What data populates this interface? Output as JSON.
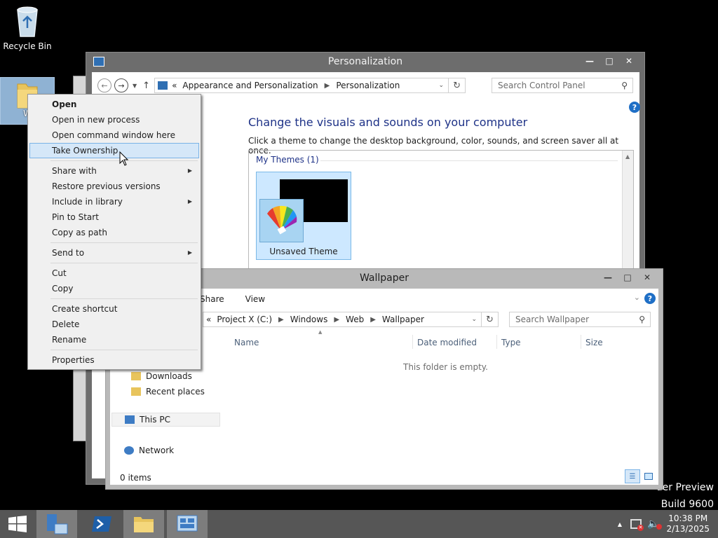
{
  "desktop": {
    "recycle_bin_label": "Recycle Bin",
    "folder_label": "W",
    "watermark_line1": "der Preview",
    "watermark_line2": "Build 9600"
  },
  "personalization": {
    "title": "Personalization",
    "breadcrumb": [
      "«",
      "Appearance and Personalization",
      "Personalization"
    ],
    "search_placeholder": "Search Control Panel",
    "heading": "Change the visuals and sounds on your computer",
    "subheading": "Click a theme to change the desktop background, color, sounds, and screen saver all at once.",
    "themes_header": "My Themes (1)",
    "theme_name": "Unsaved Theme"
  },
  "explorer": {
    "title": "Wallpaper",
    "ribbon_tabs": [
      "Share",
      "View"
    ],
    "breadcrumb": [
      "«",
      "Project X (C:)",
      "Windows",
      "Web",
      "Wallpaper"
    ],
    "search_placeholder": "Search Wallpaper",
    "columns": [
      "Name",
      "Date modified",
      "Type",
      "Size"
    ],
    "empty_message": "This folder is empty.",
    "nav": {
      "downloads": "Downloads",
      "recent": "Recent places",
      "this_pc": "This PC",
      "network": "Network"
    },
    "status": "0 items"
  },
  "context_menu": {
    "items": [
      {
        "label": "Open"
      },
      {
        "label": "Open in new process"
      },
      {
        "label": "Open command window here"
      },
      {
        "label": "Take Ownership"
      },
      {
        "label": "Share with"
      },
      {
        "label": "Restore previous versions"
      },
      {
        "label": "Include in library"
      },
      {
        "label": "Pin to Start"
      },
      {
        "label": "Copy as path"
      },
      {
        "label": "Send to"
      },
      {
        "label": "Cut"
      },
      {
        "label": "Copy"
      },
      {
        "label": "Create shortcut"
      },
      {
        "label": "Delete"
      },
      {
        "label": "Rename"
      },
      {
        "label": "Properties"
      }
    ]
  },
  "taskbar": {
    "time": "10:38 PM",
    "date": "2/13/2025"
  },
  "colors": {
    "accent": "#1e3287",
    "taskbar": "#565656",
    "menu_highlight": "#d5e7f8"
  }
}
